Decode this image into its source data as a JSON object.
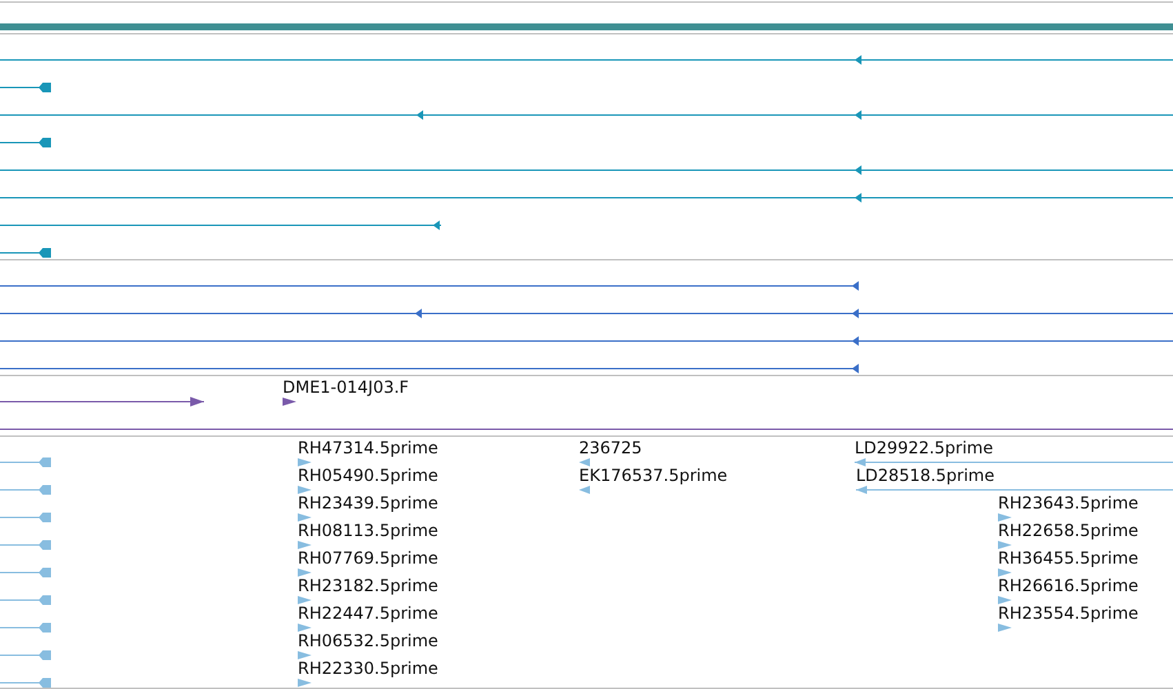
{
  "tracks": [
    {
      "kind": "bar",
      "color": "#3f8f93"
    },
    {
      "kind": "rows",
      "color": "#1996b8"
    },
    {
      "kind": "rows",
      "color": "#3a6fc8"
    },
    {
      "kind": "labeled",
      "color": "#7a5aaa",
      "features": [
        {
          "label": "DME1-014J03.F"
        }
      ]
    },
    {
      "kind": "labeled",
      "color": "#88bde0",
      "features": [
        {
          "label": "RH47314.5prime"
        },
        {
          "label": "236725"
        },
        {
          "label": "LD29922.5prime"
        },
        {
          "label": "RH05490.5prime"
        },
        {
          "label": "EK176537.5prime"
        },
        {
          "label": "LD28518.5prime"
        },
        {
          "label": "RH23439.5prime"
        },
        {
          "label": "RH23643.5prime"
        },
        {
          "label": "RH08113.5prime"
        },
        {
          "label": "RH22658.5prime"
        },
        {
          "label": "RH07769.5prime"
        },
        {
          "label": "RH36455.5prime"
        },
        {
          "label": "RH23182.5prime"
        },
        {
          "label": "RH26616.5prime"
        },
        {
          "label": "RH22447.5prime"
        },
        {
          "label": "RH23554.5prime"
        },
        {
          "label": "RH06532.5prime"
        },
        {
          "label": "RH22330.5prime"
        }
      ]
    }
  ]
}
